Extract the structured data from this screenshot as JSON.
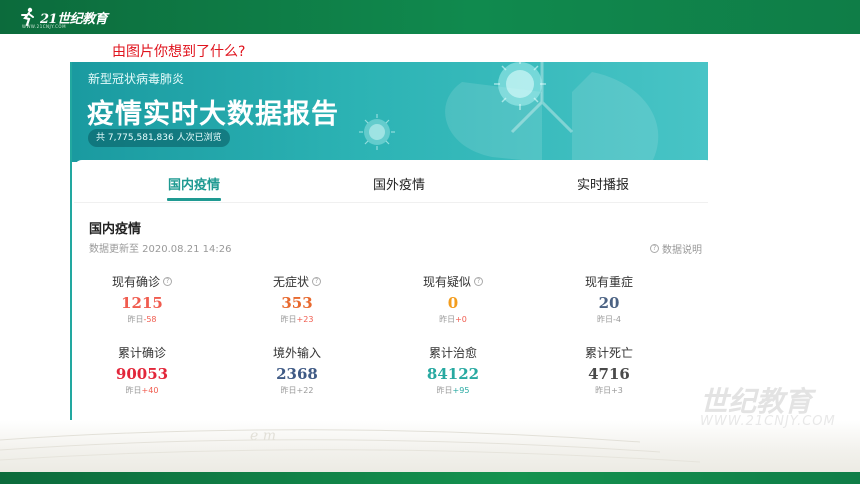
{
  "header": {
    "logo_text": "21世纪教育",
    "logo_sub": "WWW.21CNJY.COM"
  },
  "question": "由图片你想到了什么?",
  "banner": {
    "subtitle": "新型冠状病毒肺炎",
    "title": "疫情实时大数据报告",
    "views": "共 7,775,581,836 人次已浏览"
  },
  "tabs": [
    {
      "label": "国内疫情",
      "active": true
    },
    {
      "label": "国外疫情",
      "active": false
    },
    {
      "label": "实时播报",
      "active": false
    }
  ],
  "section": {
    "title": "国内疫情",
    "update": "数据更新至 2020.08.21 14:26",
    "explain": "数据说明"
  },
  "stats": [
    {
      "label": "现有确诊",
      "help": true,
      "value": "1215",
      "prefix": "昨日",
      "delta": "-58",
      "color": "#f05c4f",
      "delta_color": "#f05c4f"
    },
    {
      "label": "无症状",
      "help": true,
      "value": "353",
      "prefix": "昨日",
      "delta": "+23",
      "color": "#e8692e",
      "delta_color": "#f05c4f"
    },
    {
      "label": "现有疑似",
      "help": true,
      "value": "0",
      "prefix": "昨日",
      "delta": "+0",
      "color": "#f39c1c",
      "delta_color": "#f05c4f"
    },
    {
      "label": "现有重症",
      "help": false,
      "value": "20",
      "prefix": "昨日",
      "delta": "-4",
      "color": "#4b6283",
      "delta_color": "#999999"
    },
    {
      "label": "累计确诊",
      "help": false,
      "value": "90053",
      "prefix": "昨日",
      "delta": "+40",
      "color": "#e2263a",
      "delta_color": "#f05c4f"
    },
    {
      "label": "境外输入",
      "help": false,
      "value": "2368",
      "prefix": "昨日",
      "delta": "+22",
      "color": "#3f5a85",
      "delta_color": "#999999"
    },
    {
      "label": "累计治愈",
      "help": false,
      "value": "84122",
      "prefix": "昨日",
      "delta": "+95",
      "color": "#27a9a1",
      "delta_color": "#27a9a1"
    },
    {
      "label": "累计死亡",
      "help": false,
      "value": "4716",
      "prefix": "昨日",
      "delta": "+3",
      "color": "#4a4a4a",
      "delta_color": "#999999"
    }
  ],
  "watermark": {
    "text": "世纪教育",
    "url": "WWW.21CNJY.COM"
  }
}
